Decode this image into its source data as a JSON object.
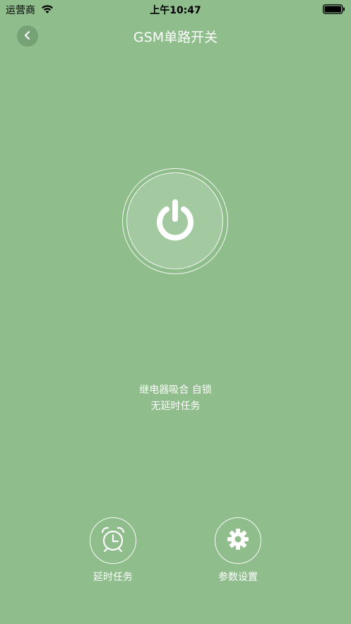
{
  "status_bar": {
    "carrier": "运营商",
    "time": "上午10:47",
    "wifi_icon": "wifi-icon",
    "battery_icon": "battery-icon"
  },
  "header": {
    "back_icon": "chevron-left-icon",
    "title": "GSM单路开关"
  },
  "power_button": {
    "icon": "power-icon"
  },
  "status": {
    "line1": "继电器吸合 自锁",
    "line2": "无延时任务"
  },
  "actions": [
    {
      "icon": "alarm-clock-icon",
      "label": "延时任务"
    },
    {
      "icon": "gear-icon",
      "label": "参数设置"
    }
  ],
  "colors": {
    "background": "#8fbd8c",
    "foreground": "#ffffff"
  }
}
